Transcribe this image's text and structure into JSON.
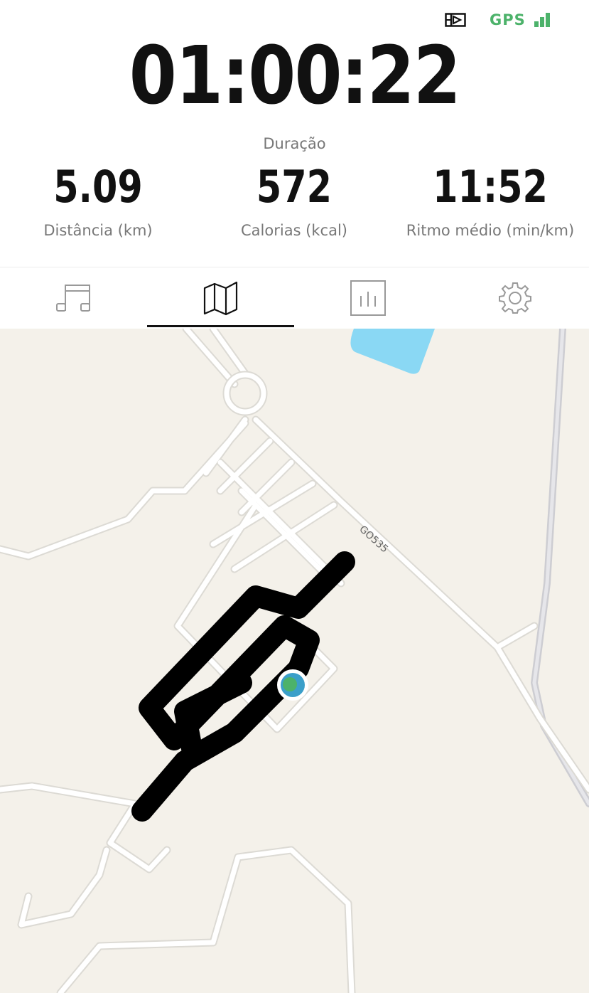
{
  "status_bar": {
    "audio_icon": "audio-cue-icon",
    "gps_label": "GPS",
    "gps_signal_icon": "signal-bars-icon",
    "gps_color": "#4cb26a"
  },
  "timer": {
    "value": "01:00:22",
    "label": "Duração"
  },
  "stats": [
    {
      "value": "5.09",
      "label": "Distância (km)"
    },
    {
      "value": "572",
      "label": "Calorias (kcal)"
    },
    {
      "value": "11:52",
      "label": "Ritmo médio (min/km)"
    }
  ],
  "tabs": [
    {
      "icon": "music-icon",
      "active": false
    },
    {
      "icon": "map-icon",
      "active": true
    },
    {
      "icon": "bar-chart-icon",
      "active": false
    },
    {
      "icon": "gear-icon",
      "active": false
    }
  ],
  "map": {
    "road_label": "GO535",
    "route_color": "#000000",
    "water_color": "#8ad8f4",
    "background_color": "#f4f1ea",
    "position_marker_color": "#4cb26a"
  }
}
